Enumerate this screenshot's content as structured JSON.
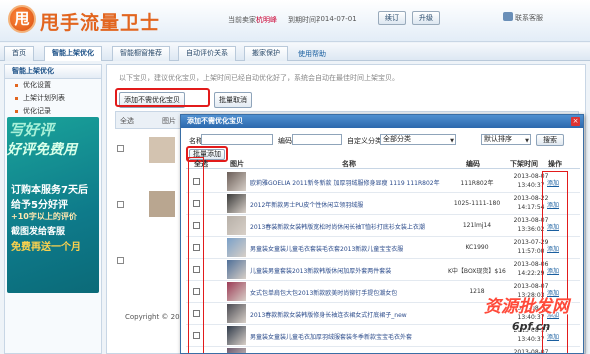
{
  "header": {
    "logo_text": "甩",
    "title": "甩手流量卫士",
    "seller_label": "当前卖家：",
    "seller_name": "杭明峰",
    "date_label": "到期时间：",
    "date_value": "2014-07-01",
    "renew_button": "续订",
    "upgrade_button": "升级",
    "contact_text": "联系客服"
  },
  "nav": {
    "tabs": [
      "首页",
      "智能上架优化",
      "智能橱窗推荐",
      "自动评价关系",
      "搬家保护"
    ],
    "active_index": 1,
    "help": "使用帮助"
  },
  "sidebar": {
    "header": "智能上架优化",
    "items": [
      "优化设置",
      "上架计划列表",
      "优化记录"
    ],
    "promo": {
      "line1": "写好评",
      "line2": "好评免费用",
      "line3": "订购本服务7天后",
      "line4": "给予5分好评",
      "line5": "+10字以上的评价",
      "line6": "截图发给客服",
      "line7": "免费再送一个月"
    }
  },
  "main": {
    "tip": "以下宝贝，建议优化宝贝，上架时间已经自动优化好了，系统会自动在最佳时间上架宝贝。",
    "add_button": "添加不需优化宝贝",
    "cancel_button": "批量取消",
    "table_header_all": "全选",
    "table_header_image": "图片",
    "copyright": "Copyright © 2013"
  },
  "dialog": {
    "title": "添加不需优化宝贝",
    "close": "×",
    "filter": {
      "name_label": "名称",
      "code_label": "编码",
      "category_label": "自定义分类",
      "category_value": "全部分类",
      "sort_value": "默认排序",
      "search_button": "搜索"
    },
    "batch_add_button": "批量添加",
    "columns": {
      "select_all": "全选",
      "image": "图片",
      "name": "名称",
      "code": "编码",
      "time": "下架时间",
      "action": "操作"
    },
    "rows": [
      {
        "name": "欧莉雅GOELIA 2011新冬新款 加厚羽绒服修身显瘦 1119 111R802年",
        "code": "111R802年",
        "date": "2013-08-07",
        "clock": "13:40:37",
        "action": "添加",
        "thumb_color": "#6b5e58"
      },
      {
        "name": "2012年新款男士PU皮个性休闲立领羽绒服",
        "code": "1025-1111-180",
        "date": "2013-08-22",
        "clock": "14:17:54",
        "action": "添加",
        "thumb_color": "#3a3a3a"
      },
      {
        "name": "2013春装新款女装韩版宽松时尚休闲长袖T恤衫打底衫女装上衣潮",
        "code": "121lmj14",
        "date": "2013-08-07",
        "clock": "13:36:02",
        "action": "添加",
        "thumb_color": "#b7b0a8"
      },
      {
        "name": "男童装女童装儿童毛衣套装毛衣套2013新款儿童宝宝衣服",
        "code": "KC1990",
        "date": "2013-07-29",
        "clock": "11:57:00",
        "action": "添加",
        "thumb_color": "#7aa0c8"
      },
      {
        "name": "儿童装男童套装2013新款韩版休闲加厚外套两件套装",
        "code": "K中【BOX现货】$16元",
        "date": "2013-08-06",
        "clock": "14:22:29",
        "action": "添加",
        "thumb_color": "#4f6f98"
      },
      {
        "name": "女式包单肩包大包2013新款欧美时尚铆钉手提包潮女包",
        "code": "1218",
        "date": "2013-08-07",
        "clock": "13:28:03",
        "action": "添加",
        "thumb_color": "#9c3b56"
      },
      {
        "name": "2013春款新款女装韩版修身长袖连衣裙女式打底裙子_new",
        "code": "",
        "date": "2013-08-07",
        "clock": "13:40:37",
        "action": "添加",
        "thumb_color": "#4a4a52"
      },
      {
        "name": "男童装女童装儿童毛衣加厚羽绒服套装冬季新款宝宝毛衣外套",
        "code": "",
        "date": "2013-08-07",
        "clock": "13:40:37",
        "action": "添加",
        "thumb_color": "#2f3a4a"
      },
      {
        "name": "30-35-40岁春装新款2013中年妇女装妈妈装春装长袖连衣裙潮",
        "code": "",
        "date": "2013-08-07",
        "clock": "13:40:37",
        "action": "添加",
        "thumb_color": "#6d5a70"
      }
    ]
  },
  "watermark": {
    "line1": "资源批发网",
    "line2": "6pf.cn"
  }
}
